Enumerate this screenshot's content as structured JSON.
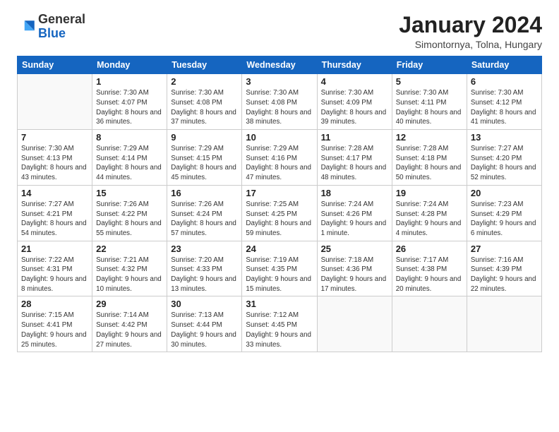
{
  "logo": {
    "general": "General",
    "blue": "Blue"
  },
  "title": "January 2024",
  "subtitle": "Simontornya, Tolna, Hungary",
  "columns": [
    "Sunday",
    "Monday",
    "Tuesday",
    "Wednesday",
    "Thursday",
    "Friday",
    "Saturday"
  ],
  "weeks": [
    [
      {
        "day": "",
        "sunrise": "",
        "sunset": "",
        "daylight": ""
      },
      {
        "day": "1",
        "sunrise": "Sunrise: 7:30 AM",
        "sunset": "Sunset: 4:07 PM",
        "daylight": "Daylight: 8 hours and 36 minutes."
      },
      {
        "day": "2",
        "sunrise": "Sunrise: 7:30 AM",
        "sunset": "Sunset: 4:08 PM",
        "daylight": "Daylight: 8 hours and 37 minutes."
      },
      {
        "day": "3",
        "sunrise": "Sunrise: 7:30 AM",
        "sunset": "Sunset: 4:08 PM",
        "daylight": "Daylight: 8 hours and 38 minutes."
      },
      {
        "day": "4",
        "sunrise": "Sunrise: 7:30 AM",
        "sunset": "Sunset: 4:09 PM",
        "daylight": "Daylight: 8 hours and 39 minutes."
      },
      {
        "day": "5",
        "sunrise": "Sunrise: 7:30 AM",
        "sunset": "Sunset: 4:11 PM",
        "daylight": "Daylight: 8 hours and 40 minutes."
      },
      {
        "day": "6",
        "sunrise": "Sunrise: 7:30 AM",
        "sunset": "Sunset: 4:12 PM",
        "daylight": "Daylight: 8 hours and 41 minutes."
      }
    ],
    [
      {
        "day": "7",
        "sunrise": "Sunrise: 7:30 AM",
        "sunset": "Sunset: 4:13 PM",
        "daylight": "Daylight: 8 hours and 43 minutes."
      },
      {
        "day": "8",
        "sunrise": "Sunrise: 7:29 AM",
        "sunset": "Sunset: 4:14 PM",
        "daylight": "Daylight: 8 hours and 44 minutes."
      },
      {
        "day": "9",
        "sunrise": "Sunrise: 7:29 AM",
        "sunset": "Sunset: 4:15 PM",
        "daylight": "Daylight: 8 hours and 45 minutes."
      },
      {
        "day": "10",
        "sunrise": "Sunrise: 7:29 AM",
        "sunset": "Sunset: 4:16 PM",
        "daylight": "Daylight: 8 hours and 47 minutes."
      },
      {
        "day": "11",
        "sunrise": "Sunrise: 7:28 AM",
        "sunset": "Sunset: 4:17 PM",
        "daylight": "Daylight: 8 hours and 48 minutes."
      },
      {
        "day": "12",
        "sunrise": "Sunrise: 7:28 AM",
        "sunset": "Sunset: 4:18 PM",
        "daylight": "Daylight: 8 hours and 50 minutes."
      },
      {
        "day": "13",
        "sunrise": "Sunrise: 7:27 AM",
        "sunset": "Sunset: 4:20 PM",
        "daylight": "Daylight: 8 hours and 52 minutes."
      }
    ],
    [
      {
        "day": "14",
        "sunrise": "Sunrise: 7:27 AM",
        "sunset": "Sunset: 4:21 PM",
        "daylight": "Daylight: 8 hours and 54 minutes."
      },
      {
        "day": "15",
        "sunrise": "Sunrise: 7:26 AM",
        "sunset": "Sunset: 4:22 PM",
        "daylight": "Daylight: 8 hours and 55 minutes."
      },
      {
        "day": "16",
        "sunrise": "Sunrise: 7:26 AM",
        "sunset": "Sunset: 4:24 PM",
        "daylight": "Daylight: 8 hours and 57 minutes."
      },
      {
        "day": "17",
        "sunrise": "Sunrise: 7:25 AM",
        "sunset": "Sunset: 4:25 PM",
        "daylight": "Daylight: 8 hours and 59 minutes."
      },
      {
        "day": "18",
        "sunrise": "Sunrise: 7:24 AM",
        "sunset": "Sunset: 4:26 PM",
        "daylight": "Daylight: 9 hours and 1 minute."
      },
      {
        "day": "19",
        "sunrise": "Sunrise: 7:24 AM",
        "sunset": "Sunset: 4:28 PM",
        "daylight": "Daylight: 9 hours and 4 minutes."
      },
      {
        "day": "20",
        "sunrise": "Sunrise: 7:23 AM",
        "sunset": "Sunset: 4:29 PM",
        "daylight": "Daylight: 9 hours and 6 minutes."
      }
    ],
    [
      {
        "day": "21",
        "sunrise": "Sunrise: 7:22 AM",
        "sunset": "Sunset: 4:31 PM",
        "daylight": "Daylight: 9 hours and 8 minutes."
      },
      {
        "day": "22",
        "sunrise": "Sunrise: 7:21 AM",
        "sunset": "Sunset: 4:32 PM",
        "daylight": "Daylight: 9 hours and 10 minutes."
      },
      {
        "day": "23",
        "sunrise": "Sunrise: 7:20 AM",
        "sunset": "Sunset: 4:33 PM",
        "daylight": "Daylight: 9 hours and 13 minutes."
      },
      {
        "day": "24",
        "sunrise": "Sunrise: 7:19 AM",
        "sunset": "Sunset: 4:35 PM",
        "daylight": "Daylight: 9 hours and 15 minutes."
      },
      {
        "day": "25",
        "sunrise": "Sunrise: 7:18 AM",
        "sunset": "Sunset: 4:36 PM",
        "daylight": "Daylight: 9 hours and 17 minutes."
      },
      {
        "day": "26",
        "sunrise": "Sunrise: 7:17 AM",
        "sunset": "Sunset: 4:38 PM",
        "daylight": "Daylight: 9 hours and 20 minutes."
      },
      {
        "day": "27",
        "sunrise": "Sunrise: 7:16 AM",
        "sunset": "Sunset: 4:39 PM",
        "daylight": "Daylight: 9 hours and 22 minutes."
      }
    ],
    [
      {
        "day": "28",
        "sunrise": "Sunrise: 7:15 AM",
        "sunset": "Sunset: 4:41 PM",
        "daylight": "Daylight: 9 hours and 25 minutes."
      },
      {
        "day": "29",
        "sunrise": "Sunrise: 7:14 AM",
        "sunset": "Sunset: 4:42 PM",
        "daylight": "Daylight: 9 hours and 27 minutes."
      },
      {
        "day": "30",
        "sunrise": "Sunrise: 7:13 AM",
        "sunset": "Sunset: 4:44 PM",
        "daylight": "Daylight: 9 hours and 30 minutes."
      },
      {
        "day": "31",
        "sunrise": "Sunrise: 7:12 AM",
        "sunset": "Sunset: 4:45 PM",
        "daylight": "Daylight: 9 hours and 33 minutes."
      },
      {
        "day": "",
        "sunrise": "",
        "sunset": "",
        "daylight": ""
      },
      {
        "day": "",
        "sunrise": "",
        "sunset": "",
        "daylight": ""
      },
      {
        "day": "",
        "sunrise": "",
        "sunset": "",
        "daylight": ""
      }
    ]
  ]
}
